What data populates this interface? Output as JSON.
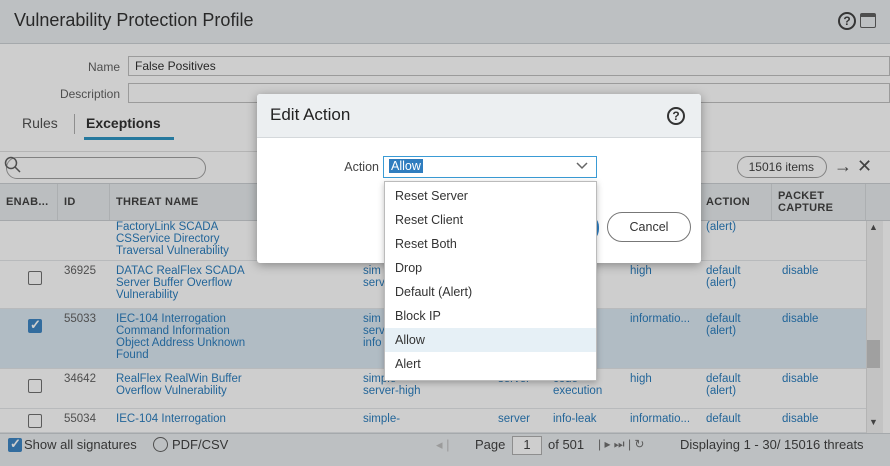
{
  "window": {
    "title": "Vulnerability Protection Profile"
  },
  "form": {
    "name_label": "Name",
    "name_value": "False Positives",
    "description_label": "Description",
    "description_value": ""
  },
  "tabs": [
    {
      "label": "Rules"
    },
    {
      "label": "Exceptions"
    }
  ],
  "search": {
    "placeholder": "",
    "items_count": "15016 items"
  },
  "table": {
    "columns": [
      "ENAB...",
      "ID",
      "THREAT NAME",
      "",
      "",
      "",
      "",
      "",
      "ACTION",
      "PACKET CAPTURE"
    ],
    "rows": [
      {
        "enabled": false,
        "id": "",
        "threat": "FactoryLink SCADA CSService Directory Traversal Vulnerability",
        "action": "(alert)",
        "capture": "",
        "selected": false
      },
      {
        "enabled": false,
        "id": "36925",
        "threat": "DATAC RealFlex SCADA Server Buffer Overflow Vulnerability",
        "ip": "sim serv",
        "severity": "high",
        "action": "default (alert)",
        "capture": "disable",
        "selected": false
      },
      {
        "enabled": true,
        "id": "55033",
        "threat": "IEC-104 Interrogation Command Information Object Address Unknown Found",
        "ip": "sim serv info",
        "severity": "informatio...",
        "action": "default (alert)",
        "capture": "disable",
        "selected": true
      },
      {
        "enabled": false,
        "id": "34642",
        "threat": "RealFlex RealWin Buffer Overflow Vulnerability",
        "ip": "simple-server-high",
        "host": "server",
        "category": "code-execution",
        "severity": "high",
        "action": "default (alert)",
        "capture": "disable",
        "selected": false
      },
      {
        "enabled": false,
        "id": "55034",
        "threat": "IEC-104 Interrogation",
        "ip": "simple-",
        "host": "server",
        "category": "info-leak",
        "severity": "informatio...",
        "action": "default",
        "capture": "disable",
        "selected": false
      }
    ]
  },
  "footer": {
    "show_all": "Show all signatures",
    "pdf_csv": "PDF/CSV",
    "page_label": "Page",
    "page_value": "1",
    "of_pages": "of 501",
    "displaying": "Displaying 1 - 30/ 15016 threats"
  },
  "modal": {
    "title": "Edit Action",
    "action_label": "Action",
    "action_value": "Allow",
    "cancel_label": "Cancel",
    "options": [
      "Reset Server",
      "Reset Client",
      "Reset Both",
      "Drop",
      "Default (Alert)",
      "Block IP",
      "Allow",
      "Alert"
    ],
    "highlighted_option": "Allow"
  },
  "colors": {
    "accent": "#2f7dbf",
    "link": "#1a73b8",
    "header_bg": "#e9edef"
  }
}
